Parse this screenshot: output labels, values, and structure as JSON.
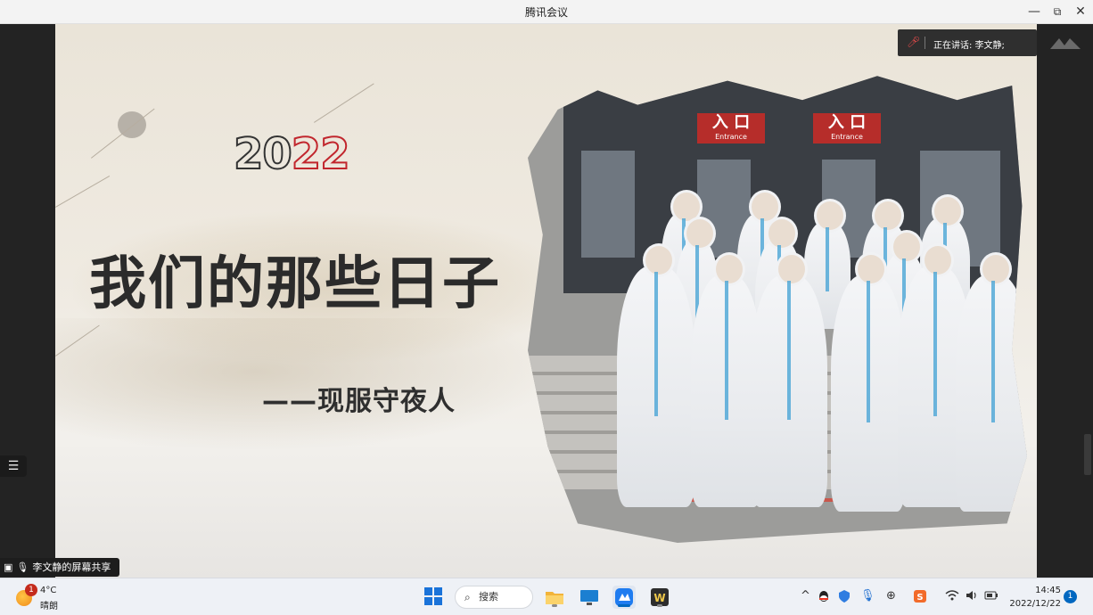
{
  "window": {
    "title": "腾讯会议",
    "minimize": "—",
    "restore": "⧉",
    "close": "✕"
  },
  "meeting": {
    "speaking_label": "正在讲话: 李文静;",
    "share_label": "李文静的屏幕共享",
    "menu_icon": "☰"
  },
  "slide": {
    "year_a": "20",
    "year_b": "22",
    "heading": "我们的那些日子",
    "subheading": "——现服守夜人",
    "photo_sign": "入 口",
    "photo_sign_en": "Entrance"
  },
  "taskbar": {
    "weather_badge": "1",
    "temperature": "4°C",
    "condition": "晴朗",
    "search_label": "搜索",
    "search_icon": "⌕",
    "tray_chevron": "^",
    "time": "14:45",
    "date": "2022/12/22",
    "notification_count": "1"
  },
  "colors": {
    "accent_red": "#c1262d",
    "taskbar_blue": "#0067c0",
    "dark_bg": "#232323"
  }
}
